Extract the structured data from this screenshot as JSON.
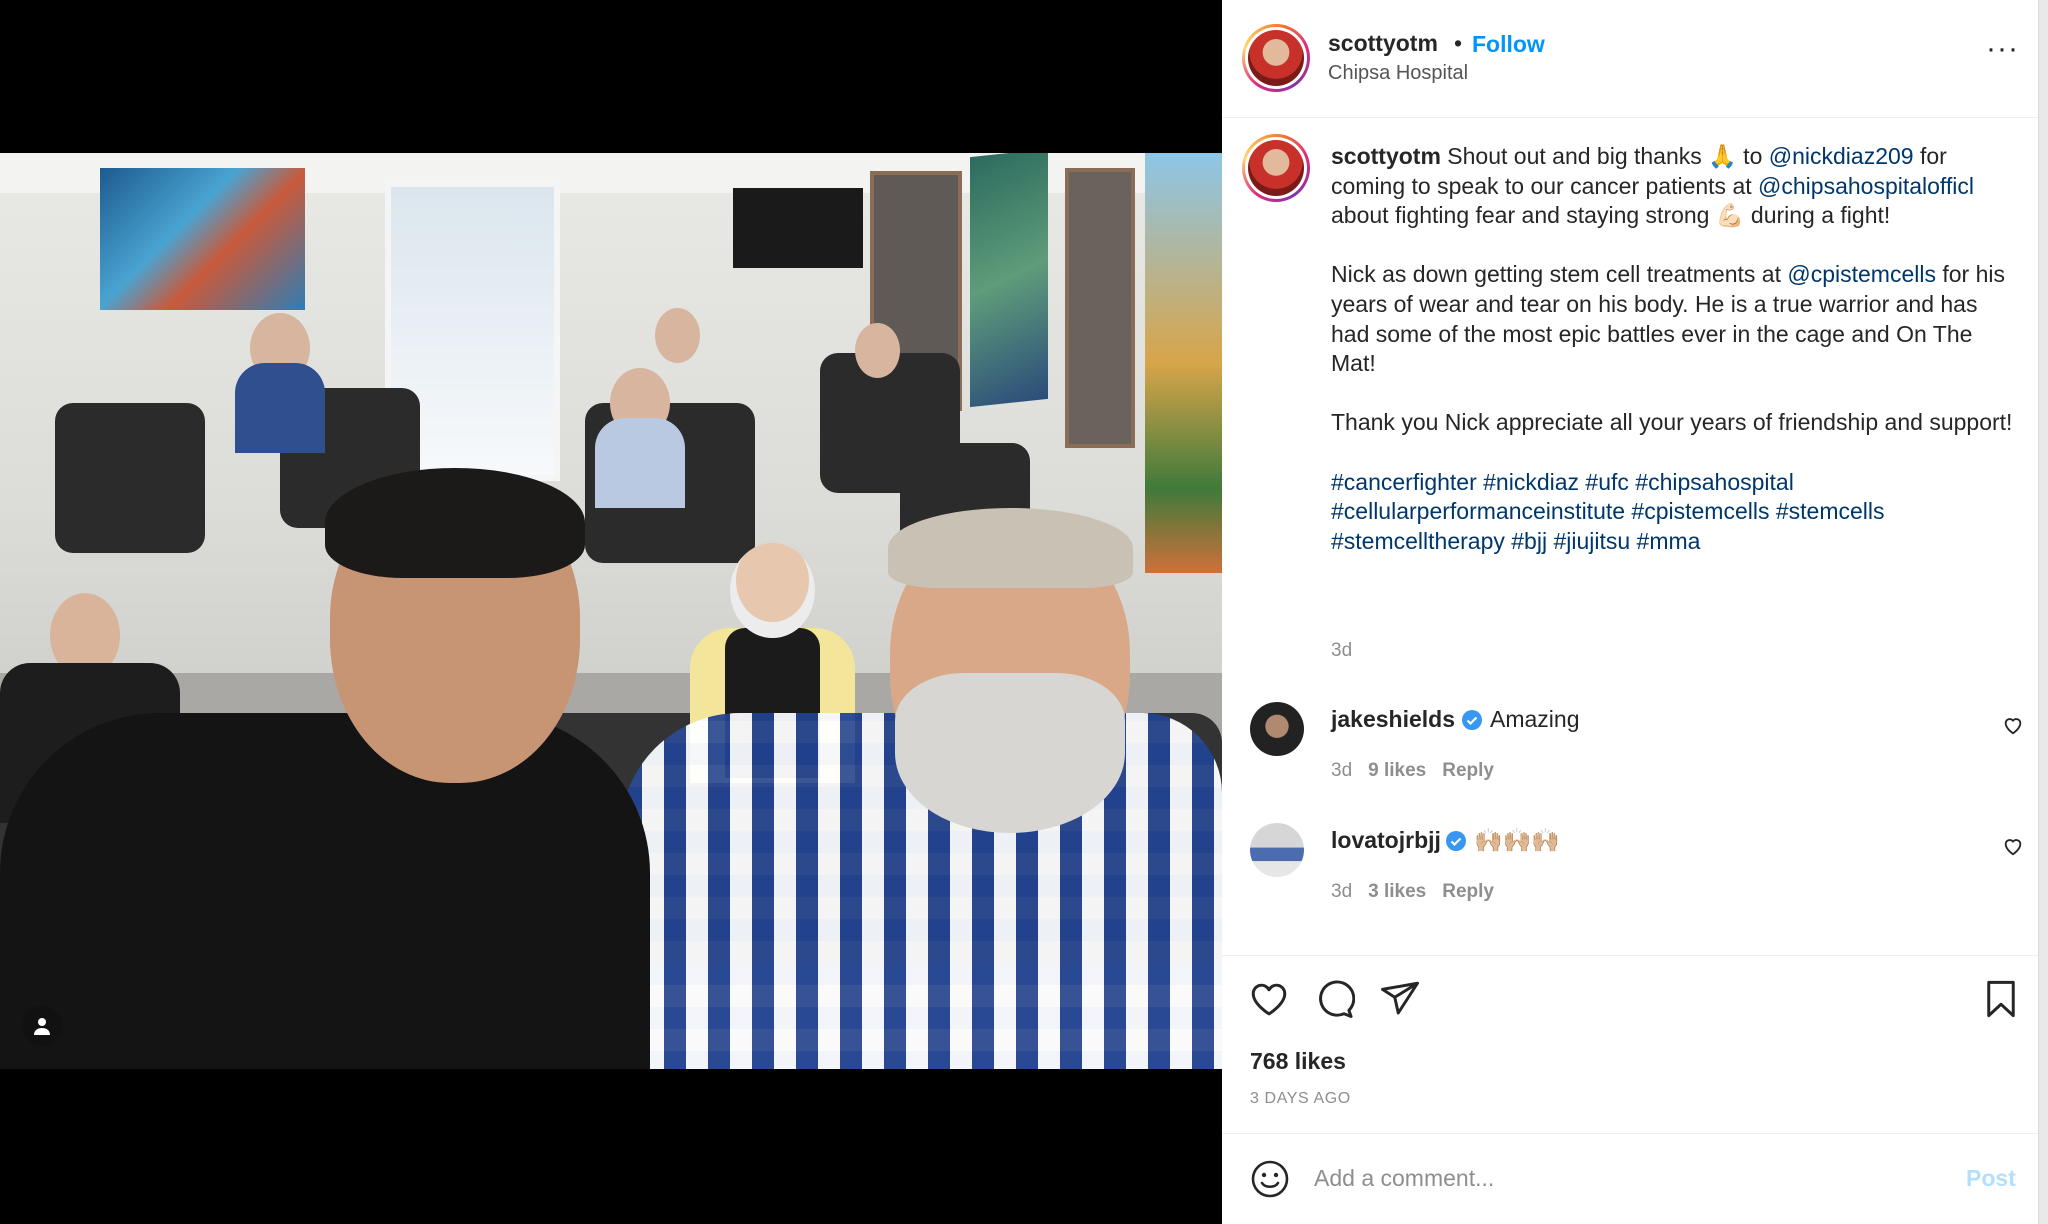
{
  "post": {
    "username": "scottyotm",
    "separator": "•",
    "follow_label": "Follow",
    "location": "Chipsa Hospital",
    "more_label": "···"
  },
  "caption": {
    "username": "scottyotm",
    "p1_a": " Shout out and big thanks 🙏 to ",
    "p1_m1": "@nickdiaz209",
    "p1_b": " for coming to speak to our cancer patients at ",
    "p1_m2": "@chipsahospitalofficl",
    "p1_c": " about fighting fear and staying strong 💪🏻 during a fight!",
    "p2_a": "Nick as down getting stem cell treatments at ",
    "p2_m1": "@cpistemcells",
    "p2_b": " for his years of wear and tear on his body. He is a true warrior and has had some of the most epic battles ever in the cage and On The Mat!",
    "p3": "Thank you Nick appreciate all your years of friendship and support!",
    "hashtags": "#cancerfighter #nickdiaz #ufc #chipsahospital #cellularperformanceinstitute #cpistemcells #stemcells #stemcelltherapy #bjj #jiujitsu #mma",
    "time": "3d"
  },
  "comments": [
    {
      "username": "jakeshields",
      "verified": true,
      "text": "Amazing",
      "time": "3d",
      "likes": "9 likes",
      "reply": "Reply"
    },
    {
      "username": "lovatojrbjj",
      "verified": true,
      "text": "🙌🏼🙌🏼🙌🏼",
      "time": "3d",
      "likes": "3 likes",
      "reply": "Reply"
    }
  ],
  "actions": {
    "icons": [
      "heart-icon",
      "comment-icon",
      "share-icon",
      "bookmark-icon"
    ],
    "likes": "768 likes",
    "date": "3 DAYS AGO"
  },
  "add_comment": {
    "placeholder": "Add a comment...",
    "post_label": "Post"
  },
  "colors": {
    "link": "#0095f6",
    "mention": "#00376b",
    "muted": "#8e8e8e",
    "verified": "#3897f0",
    "post_disabled": "#b2dffc"
  }
}
